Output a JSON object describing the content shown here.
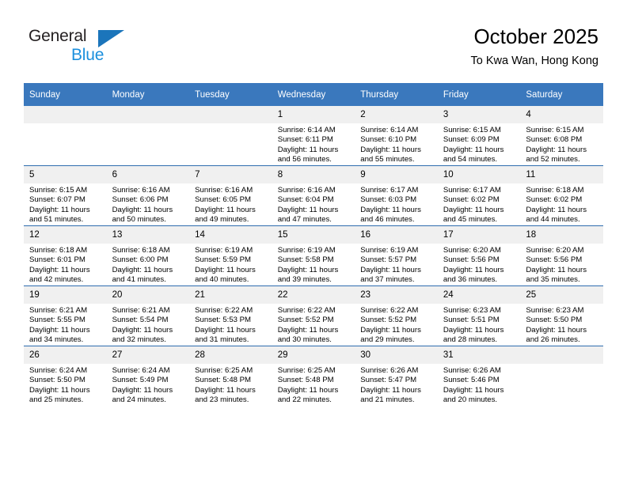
{
  "brand": {
    "name_top": "General",
    "name_bottom": "Blue",
    "triangle_color": "#1b75bb",
    "blue_color": "#1b8fdd"
  },
  "header": {
    "title": "October 2025",
    "subtitle": "To Kwa Wan, Hong Kong"
  },
  "theme": {
    "header_blue": "#3a78bd",
    "row_divider": "#2f6daf",
    "daynum_band": "#f0f0f0"
  },
  "calendar": {
    "weekday_headers": [
      "Sunday",
      "Monday",
      "Tuesday",
      "Wednesday",
      "Thursday",
      "Friday",
      "Saturday"
    ],
    "labels": {
      "sunrise": "Sunrise:",
      "sunset": "Sunset:",
      "daylight": "Daylight:"
    },
    "weeks": [
      [
        {
          "day": "",
          "empty": true
        },
        {
          "day": "",
          "empty": true
        },
        {
          "day": "",
          "empty": true
        },
        {
          "day": "1",
          "sunrise": "Sunrise: 6:14 AM",
          "sunset": "Sunset: 6:11 PM",
          "daylight_line1": "Daylight: 11 hours",
          "daylight_line2": "and 56 minutes."
        },
        {
          "day": "2",
          "sunrise": "Sunrise: 6:14 AM",
          "sunset": "Sunset: 6:10 PM",
          "daylight_line1": "Daylight: 11 hours",
          "daylight_line2": "and 55 minutes."
        },
        {
          "day": "3",
          "sunrise": "Sunrise: 6:15 AM",
          "sunset": "Sunset: 6:09 PM",
          "daylight_line1": "Daylight: 11 hours",
          "daylight_line2": "and 54 minutes."
        },
        {
          "day": "4",
          "sunrise": "Sunrise: 6:15 AM",
          "sunset": "Sunset: 6:08 PM",
          "daylight_line1": "Daylight: 11 hours",
          "daylight_line2": "and 52 minutes."
        }
      ],
      [
        {
          "day": "5",
          "sunrise": "Sunrise: 6:15 AM",
          "sunset": "Sunset: 6:07 PM",
          "daylight_line1": "Daylight: 11 hours",
          "daylight_line2": "and 51 minutes."
        },
        {
          "day": "6",
          "sunrise": "Sunrise: 6:16 AM",
          "sunset": "Sunset: 6:06 PM",
          "daylight_line1": "Daylight: 11 hours",
          "daylight_line2": "and 50 minutes."
        },
        {
          "day": "7",
          "sunrise": "Sunrise: 6:16 AM",
          "sunset": "Sunset: 6:05 PM",
          "daylight_line1": "Daylight: 11 hours",
          "daylight_line2": "and 49 minutes."
        },
        {
          "day": "8",
          "sunrise": "Sunrise: 6:16 AM",
          "sunset": "Sunset: 6:04 PM",
          "daylight_line1": "Daylight: 11 hours",
          "daylight_line2": "and 47 minutes."
        },
        {
          "day": "9",
          "sunrise": "Sunrise: 6:17 AM",
          "sunset": "Sunset: 6:03 PM",
          "daylight_line1": "Daylight: 11 hours",
          "daylight_line2": "and 46 minutes."
        },
        {
          "day": "10",
          "sunrise": "Sunrise: 6:17 AM",
          "sunset": "Sunset: 6:02 PM",
          "daylight_line1": "Daylight: 11 hours",
          "daylight_line2": "and 45 minutes."
        },
        {
          "day": "11",
          "sunrise": "Sunrise: 6:18 AM",
          "sunset": "Sunset: 6:02 PM",
          "daylight_line1": "Daylight: 11 hours",
          "daylight_line2": "and 44 minutes."
        }
      ],
      [
        {
          "day": "12",
          "sunrise": "Sunrise: 6:18 AM",
          "sunset": "Sunset: 6:01 PM",
          "daylight_line1": "Daylight: 11 hours",
          "daylight_line2": "and 42 minutes."
        },
        {
          "day": "13",
          "sunrise": "Sunrise: 6:18 AM",
          "sunset": "Sunset: 6:00 PM",
          "daylight_line1": "Daylight: 11 hours",
          "daylight_line2": "and 41 minutes."
        },
        {
          "day": "14",
          "sunrise": "Sunrise: 6:19 AM",
          "sunset": "Sunset: 5:59 PM",
          "daylight_line1": "Daylight: 11 hours",
          "daylight_line2": "and 40 minutes."
        },
        {
          "day": "15",
          "sunrise": "Sunrise: 6:19 AM",
          "sunset": "Sunset: 5:58 PM",
          "daylight_line1": "Daylight: 11 hours",
          "daylight_line2": "and 39 minutes."
        },
        {
          "day": "16",
          "sunrise": "Sunrise: 6:19 AM",
          "sunset": "Sunset: 5:57 PM",
          "daylight_line1": "Daylight: 11 hours",
          "daylight_line2": "and 37 minutes."
        },
        {
          "day": "17",
          "sunrise": "Sunrise: 6:20 AM",
          "sunset": "Sunset: 5:56 PM",
          "daylight_line1": "Daylight: 11 hours",
          "daylight_line2": "and 36 minutes."
        },
        {
          "day": "18",
          "sunrise": "Sunrise: 6:20 AM",
          "sunset": "Sunset: 5:56 PM",
          "daylight_line1": "Daylight: 11 hours",
          "daylight_line2": "and 35 minutes."
        }
      ],
      [
        {
          "day": "19",
          "sunrise": "Sunrise: 6:21 AM",
          "sunset": "Sunset: 5:55 PM",
          "daylight_line1": "Daylight: 11 hours",
          "daylight_line2": "and 34 minutes."
        },
        {
          "day": "20",
          "sunrise": "Sunrise: 6:21 AM",
          "sunset": "Sunset: 5:54 PM",
          "daylight_line1": "Daylight: 11 hours",
          "daylight_line2": "and 32 minutes."
        },
        {
          "day": "21",
          "sunrise": "Sunrise: 6:22 AM",
          "sunset": "Sunset: 5:53 PM",
          "daylight_line1": "Daylight: 11 hours",
          "daylight_line2": "and 31 minutes."
        },
        {
          "day": "22",
          "sunrise": "Sunrise: 6:22 AM",
          "sunset": "Sunset: 5:52 PM",
          "daylight_line1": "Daylight: 11 hours",
          "daylight_line2": "and 30 minutes."
        },
        {
          "day": "23",
          "sunrise": "Sunrise: 6:22 AM",
          "sunset": "Sunset: 5:52 PM",
          "daylight_line1": "Daylight: 11 hours",
          "daylight_line2": "and 29 minutes."
        },
        {
          "day": "24",
          "sunrise": "Sunrise: 6:23 AM",
          "sunset": "Sunset: 5:51 PM",
          "daylight_line1": "Daylight: 11 hours",
          "daylight_line2": "and 28 minutes."
        },
        {
          "day": "25",
          "sunrise": "Sunrise: 6:23 AM",
          "sunset": "Sunset: 5:50 PM",
          "daylight_line1": "Daylight: 11 hours",
          "daylight_line2": "and 26 minutes."
        }
      ],
      [
        {
          "day": "26",
          "sunrise": "Sunrise: 6:24 AM",
          "sunset": "Sunset: 5:50 PM",
          "daylight_line1": "Daylight: 11 hours",
          "daylight_line2": "and 25 minutes."
        },
        {
          "day": "27",
          "sunrise": "Sunrise: 6:24 AM",
          "sunset": "Sunset: 5:49 PM",
          "daylight_line1": "Daylight: 11 hours",
          "daylight_line2": "and 24 minutes."
        },
        {
          "day": "28",
          "sunrise": "Sunrise: 6:25 AM",
          "sunset": "Sunset: 5:48 PM",
          "daylight_line1": "Daylight: 11 hours",
          "daylight_line2": "and 23 minutes."
        },
        {
          "day": "29",
          "sunrise": "Sunrise: 6:25 AM",
          "sunset": "Sunset: 5:48 PM",
          "daylight_line1": "Daylight: 11 hours",
          "daylight_line2": "and 22 minutes."
        },
        {
          "day": "30",
          "sunrise": "Sunrise: 6:26 AM",
          "sunset": "Sunset: 5:47 PM",
          "daylight_line1": "Daylight: 11 hours",
          "daylight_line2": "and 21 minutes."
        },
        {
          "day": "31",
          "sunrise": "Sunrise: 6:26 AM",
          "sunset": "Sunset: 5:46 PM",
          "daylight_line1": "Daylight: 11 hours",
          "daylight_line2": "and 20 minutes."
        },
        {
          "day": "",
          "empty": true
        }
      ]
    ]
  }
}
